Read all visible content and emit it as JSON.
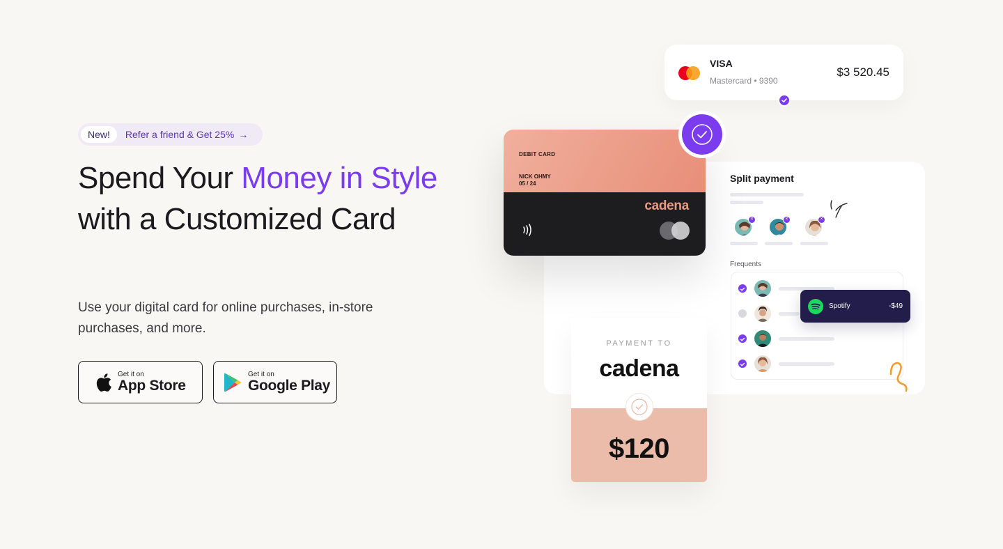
{
  "promo": {
    "badge": "New!",
    "text": "Refer a friend & Get 25%",
    "arrow": "→"
  },
  "hero": {
    "title_part1": "Spend Your ",
    "title_accent": "Money in Style",
    "title_part2": " with a Customized Card",
    "subtitle": "Use your digital card for online purchases, in-store purchases, and more."
  },
  "stores": {
    "app_small": "Get it on",
    "app_big": "App Store",
    "play_small": "Get it on",
    "play_big": "Google Play"
  },
  "visa": {
    "name": "VISA",
    "detail": "Mastercard • 9390",
    "amount": "$3 520.45"
  },
  "debit": {
    "label": "DEBIT CARD",
    "holder": "NICK OHMY",
    "expiry": "05 / 24",
    "brand": "cadena"
  },
  "split": {
    "title": "Split payment",
    "frequents_label": "Frequents"
  },
  "spotify": {
    "name": "Spotify",
    "amount": "-$49"
  },
  "payment": {
    "label": "PAYMENT TO",
    "brand": "cadena",
    "amount": "$120"
  },
  "colors": {
    "accent": "#7b3cf0",
    "background": "#f9f7f4",
    "card_peach": "#e88e78",
    "card_dark": "#1d1d1f",
    "spotify_green": "#1ed760",
    "toast_navy": "#221d4a"
  },
  "icons": [
    "arrow-right-icon",
    "apple-icon",
    "google-play-icon",
    "mastercard-icon",
    "check-icon",
    "nfc-icon",
    "spotify-icon",
    "close-icon"
  ]
}
